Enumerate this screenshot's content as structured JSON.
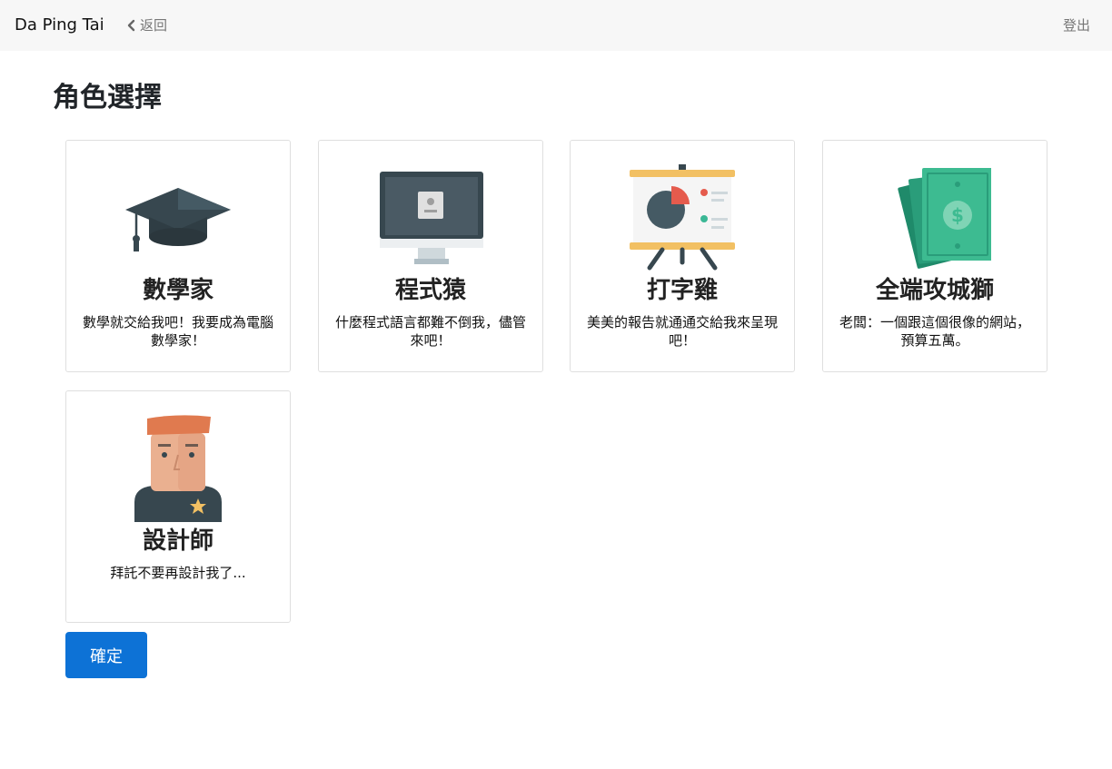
{
  "navbar": {
    "brand": "Da Ping Tai",
    "back_label": "返回",
    "logout_label": "登出"
  },
  "page": {
    "title": "角色選擇"
  },
  "roles": [
    {
      "name": "數學家",
      "description": "數學就交給我吧！我要成為電腦數學家！",
      "icon": "graduation-cap-icon"
    },
    {
      "name": "程式猿",
      "description": "什麼程式語言都難不倒我，儘管來吧！",
      "icon": "monitor-icon"
    },
    {
      "name": "打字雞",
      "description": "美美的報告就通通交給我來呈現吧！",
      "icon": "presentation-board-icon"
    },
    {
      "name": "全端攻城獅",
      "description": "老闆：一個跟這個很像的網站，預算五萬。",
      "icon": "money-icon"
    },
    {
      "name": "設計師",
      "description": "拜託不要再設計我了...",
      "icon": "designer-avatar-icon"
    }
  ],
  "confirm_label": "確定",
  "colors": {
    "navbar_bg": "#f7f7f7",
    "primary": "#0d72d6",
    "card_border": "#dfdfdf"
  }
}
